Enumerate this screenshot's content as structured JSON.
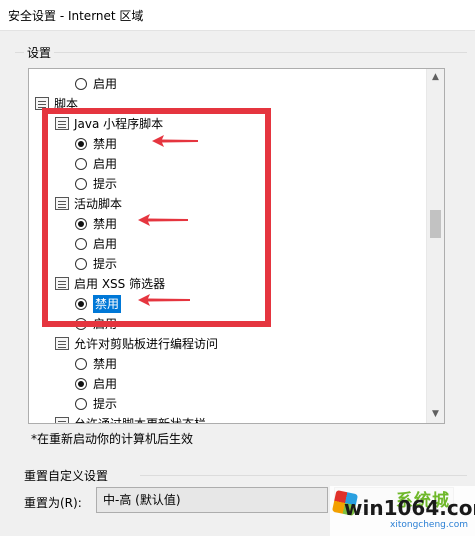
{
  "window": {
    "title": "安全设置 - Internet 区域"
  },
  "settings_group": {
    "label": "设置"
  },
  "list": [
    {
      "kind": "radio",
      "label": "启用",
      "checked": false,
      "selected": false
    },
    {
      "kind": "category",
      "label": "脚本"
    },
    {
      "kind": "setting",
      "label": "Java 小程序脚本"
    },
    {
      "kind": "radio",
      "label": "禁用",
      "checked": true,
      "selected": false
    },
    {
      "kind": "radio",
      "label": "启用",
      "checked": false,
      "selected": false
    },
    {
      "kind": "radio",
      "label": "提示",
      "checked": false,
      "selected": false
    },
    {
      "kind": "setting",
      "label": "活动脚本"
    },
    {
      "kind": "radio",
      "label": "禁用",
      "checked": true,
      "selected": false
    },
    {
      "kind": "radio",
      "label": "启用",
      "checked": false,
      "selected": false
    },
    {
      "kind": "radio",
      "label": "提示",
      "checked": false,
      "selected": false
    },
    {
      "kind": "setting",
      "label": "启用 XSS 筛选器"
    },
    {
      "kind": "radio",
      "label": "禁用",
      "checked": true,
      "selected": true
    },
    {
      "kind": "radio",
      "label": "启用",
      "checked": false,
      "selected": false
    },
    {
      "kind": "setting",
      "label": "允许对剪贴板进行编程访问"
    },
    {
      "kind": "radio",
      "label": "禁用",
      "checked": false,
      "selected": false
    },
    {
      "kind": "radio",
      "label": "启用",
      "checked": true,
      "selected": false
    },
    {
      "kind": "radio",
      "label": "提示",
      "checked": false,
      "selected": false
    },
    {
      "kind": "setting",
      "label": "允许通过脚本更新状态栏"
    }
  ],
  "note": "*在重新启动你的计算机后生效",
  "reset_group": {
    "label": "重置自定义设置",
    "reset_for_label": "重置为(R):",
    "selected_level": "中-高 (默认值)"
  },
  "watermark": {
    "text": "win1064.com",
    "brand": "系统城",
    "domain": "xitongcheng.com"
  },
  "colors": {
    "highlight_box": "#e5353f",
    "selection": "#0078d7"
  }
}
